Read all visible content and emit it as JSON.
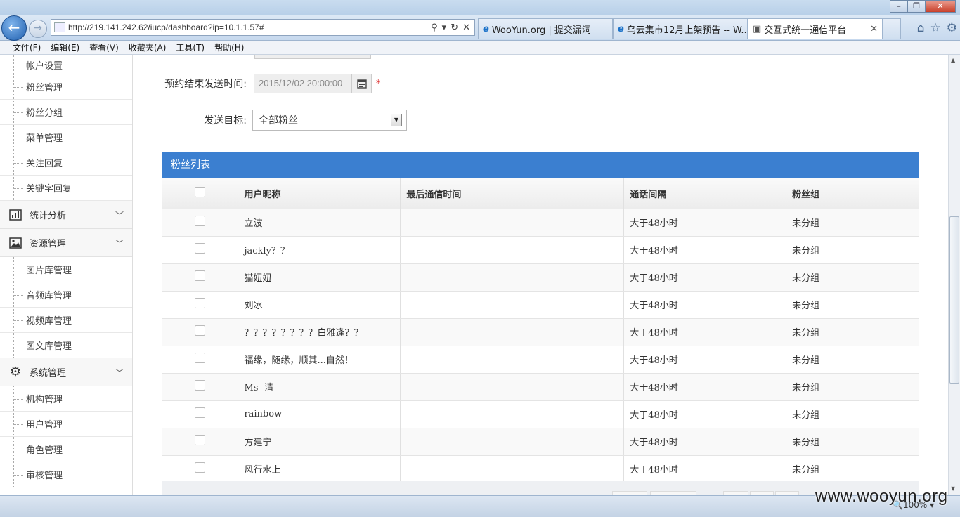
{
  "browser": {
    "url": "http://219.141.242.62/iucp/dashboard?ip=10.1.1.57#",
    "tabs": [
      {
        "label": "WooYun.org | 提交漏洞"
      },
      {
        "label": "乌云集市12月上架预告 -- W..."
      },
      {
        "label": "交互式统一通信平台"
      }
    ],
    "menu": [
      "文件(F)",
      "编辑(E)",
      "查看(V)",
      "收藏夹(A)",
      "工具(T)",
      "帮助(H)"
    ],
    "zoom": "100%"
  },
  "sidebar": {
    "sub_top": [
      "帐户设置",
      "粉丝管理",
      "粉丝分组",
      "菜单管理",
      "关注回复",
      "关键字回复"
    ],
    "groups": [
      {
        "label": "统计分析",
        "icon": "bar-chart-icon"
      },
      {
        "label": "资源管理",
        "icon": "image-icon",
        "items": [
          "图片库管理",
          "音频库管理",
          "视频库管理",
          "图文库管理"
        ]
      },
      {
        "label": "系统管理",
        "icon": "gear-icon",
        "items": [
          "机构管理",
          "用户管理",
          "角色管理",
          "审核管理"
        ]
      }
    ]
  },
  "form": {
    "end_time_label": "预约结束发送时间:",
    "end_time_value": "2015/12/02 20:00:00",
    "required_mark": "*",
    "target_label": "发送目标:",
    "target_value": "全部粉丝"
  },
  "fans_table": {
    "title": "粉丝列表",
    "columns": [
      "用户昵称",
      "最后通信时间",
      "通话间隔",
      "粉丝组"
    ],
    "rows": [
      {
        "nick": "立波",
        "last": "",
        "interval": "大于48小时",
        "group": "未分组"
      },
      {
        "nick": "jackly？？",
        "last": "",
        "interval": "大于48小时",
        "group": "未分组"
      },
      {
        "nick": "猫妞妞",
        "last": "",
        "interval": "大于48小时",
        "group": "未分组"
      },
      {
        "nick": "刘冰",
        "last": "",
        "interval": "大于48小时",
        "group": "未分组"
      },
      {
        "nick": "？？？？？？？？白雅逢？？",
        "last": "",
        "interval": "大于48小时",
        "group": "未分组"
      },
      {
        "nick": "福缘，随缘，顺其...自然！",
        "last": "",
        "interval": "大于48小时",
        "group": "未分组"
      },
      {
        "nick": "Ms--清",
        "last": "",
        "interval": "大于48小时",
        "group": "未分组"
      },
      {
        "nick": "rainbow",
        "last": "",
        "interval": "大于48小时",
        "group": "未分组"
      },
      {
        "nick": "方建宁",
        "last": "",
        "interval": "大于48小时",
        "group": "未分组"
      },
      {
        "nick": "风行水上",
        "last": "",
        "interval": "大于48小时",
        "group": "未分组"
      }
    ]
  },
  "watermark": "www.wooyun.org"
}
